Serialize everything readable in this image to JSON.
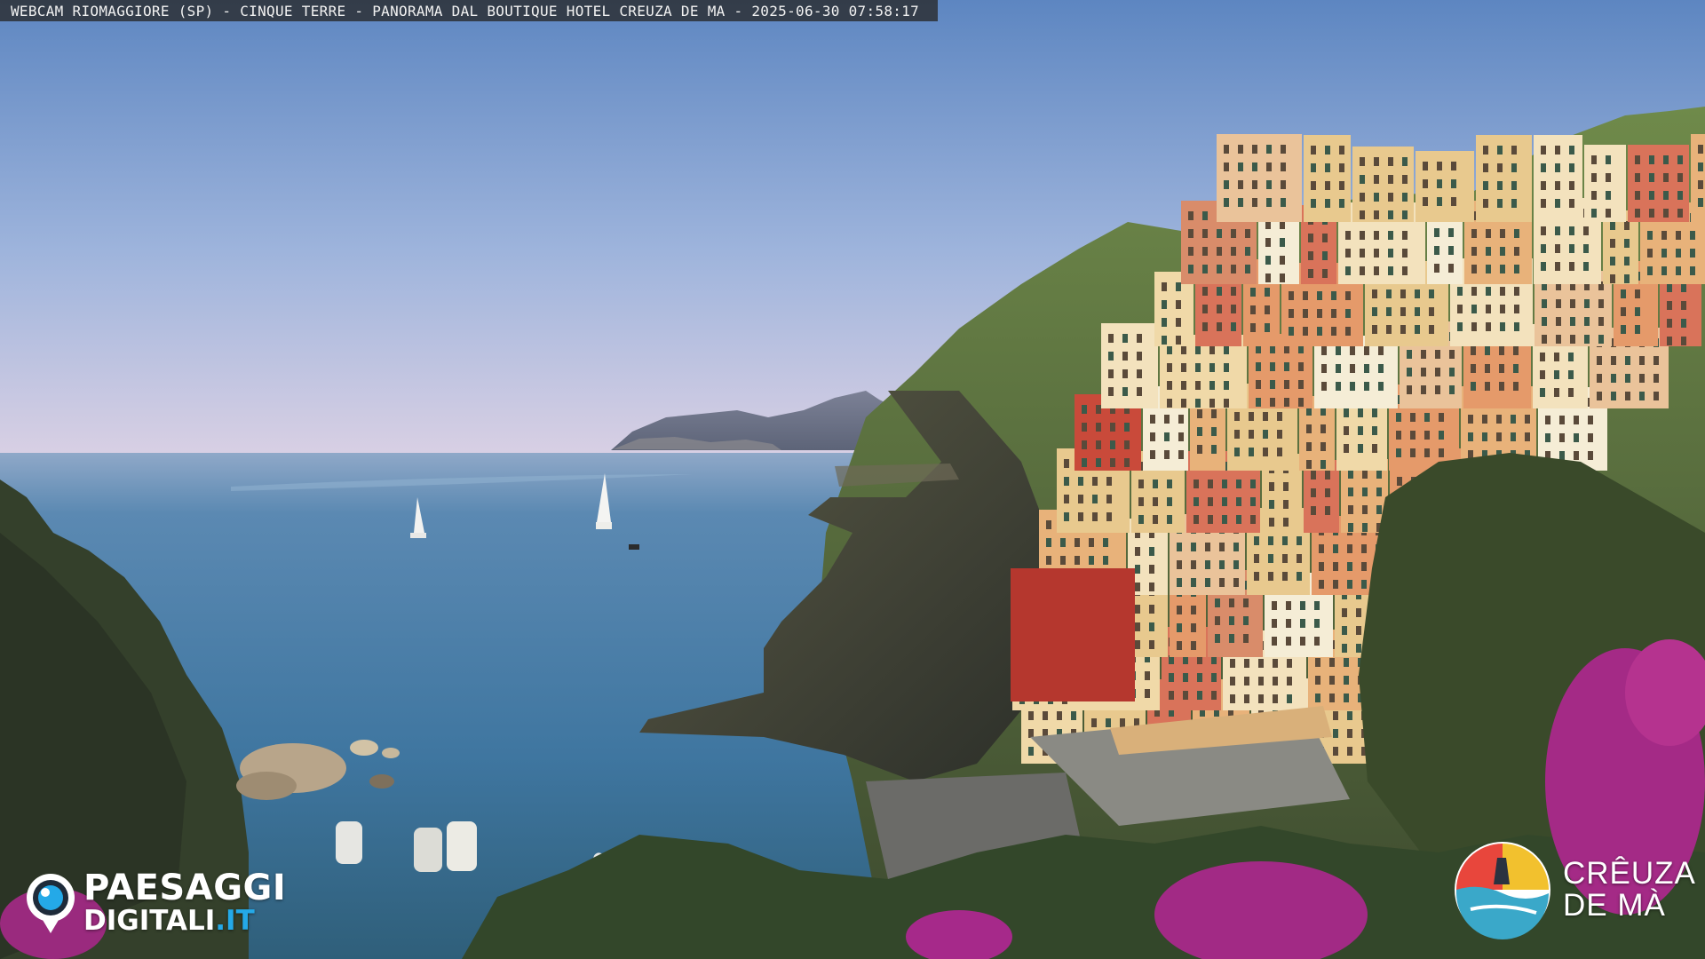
{
  "caption": {
    "text": "WEBCAM RIOMAGGIORE (SP) - CINQUE TERRE - PANORAMA DAL BOUTIQUE HOTEL CREUZA DE MA - 2025-06-30 07:58:17"
  },
  "watermark_left": {
    "brand_top": "PAESAGGI",
    "brand_bottom": "DIGITALI",
    "brand_tld": ".IT",
    "icon": "eye-icon",
    "accent_color": "#24a9e8"
  },
  "watermark_right": {
    "line1": "CRÊUZA",
    "line2": "DE MÀ",
    "icon": "hotel-logo-icon",
    "colors": [
      "#f2c12e",
      "#3aa8c9",
      "#e8463c"
    ]
  },
  "scene_colors": {
    "sky_top": "#5f88c2",
    "sky_horizon": "#d9d2e6",
    "sea": "#4a7fa8",
    "cliff": "#3c3f36",
    "vegetation": "#3e5a2c",
    "bougainvillea": "#b02a8c"
  }
}
